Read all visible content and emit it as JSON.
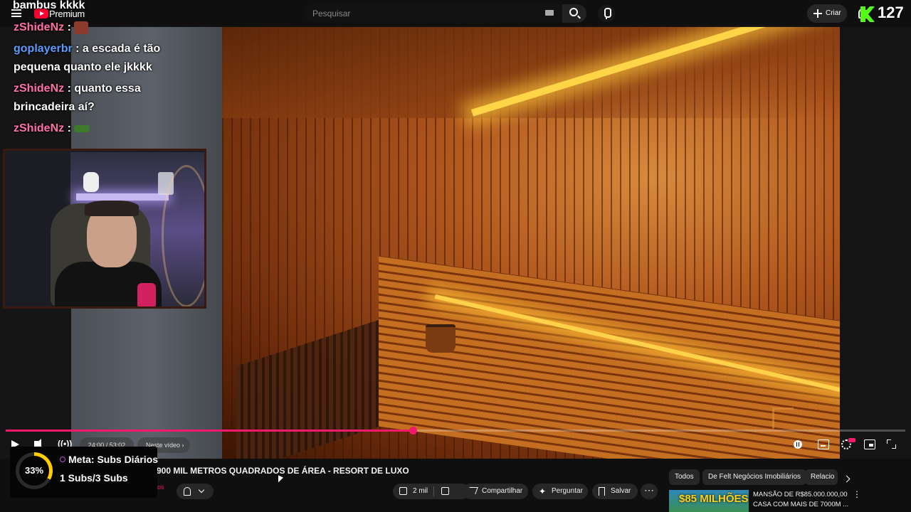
{
  "stream_overlay": {
    "title": "bambus kkkk",
    "viewer_count": "127"
  },
  "topbar": {
    "premium_label": "Premium",
    "search_placeholder": "Pesquisar",
    "create_label": "Criar"
  },
  "chat": [
    {
      "user": "zShideNz",
      "text": ":",
      "user_color": "#ff6fa8",
      "emote": "face-emote"
    },
    {
      "user": "goplayerbr",
      "text": ": a escada é tão",
      "continuation": "pequena quanto ele jkkkk",
      "user_color": "#5d9cff"
    },
    {
      "user": "zShideNz",
      "text": ": quanto essa",
      "continuation": "brincadeira aí?",
      "user_color": "#ff6fa8"
    },
    {
      "user": "zShideNz",
      "text": ":",
      "user_color": "#ff6fa8",
      "emote": "hat-emote"
    }
  ],
  "player": {
    "progress": 0.4525,
    "time": "24:00 / 53:02",
    "chapter_label": "Neste vídeo",
    "accent_color": "#f0196c"
  },
  "video": {
    "title": "900 MIL METROS QUADRADOS DE ÁREA - RESORT DE LUXO"
  },
  "actions": {
    "likes": "2 mil",
    "share": "Compartilhar",
    "ask": "Perguntar",
    "save": "Salvar",
    "more": "⋯"
  },
  "meta_widget": {
    "percent_label": "33%",
    "percent": 33,
    "title": "Meta: Subs Diários",
    "subs": "1 Subs/3 Subs",
    "tiny_text": "os"
  },
  "sidebar": {
    "chips": [
      "Todos",
      "De Felt Negócios Imobiliários",
      "Relacio"
    ],
    "rec": {
      "thumb_text": "$85 MILHÕES",
      "title_line1": "MANSÃO DE R$85.000.000,00",
      "title_line2": "CASA COM MAIS DE 7000M ..."
    }
  }
}
